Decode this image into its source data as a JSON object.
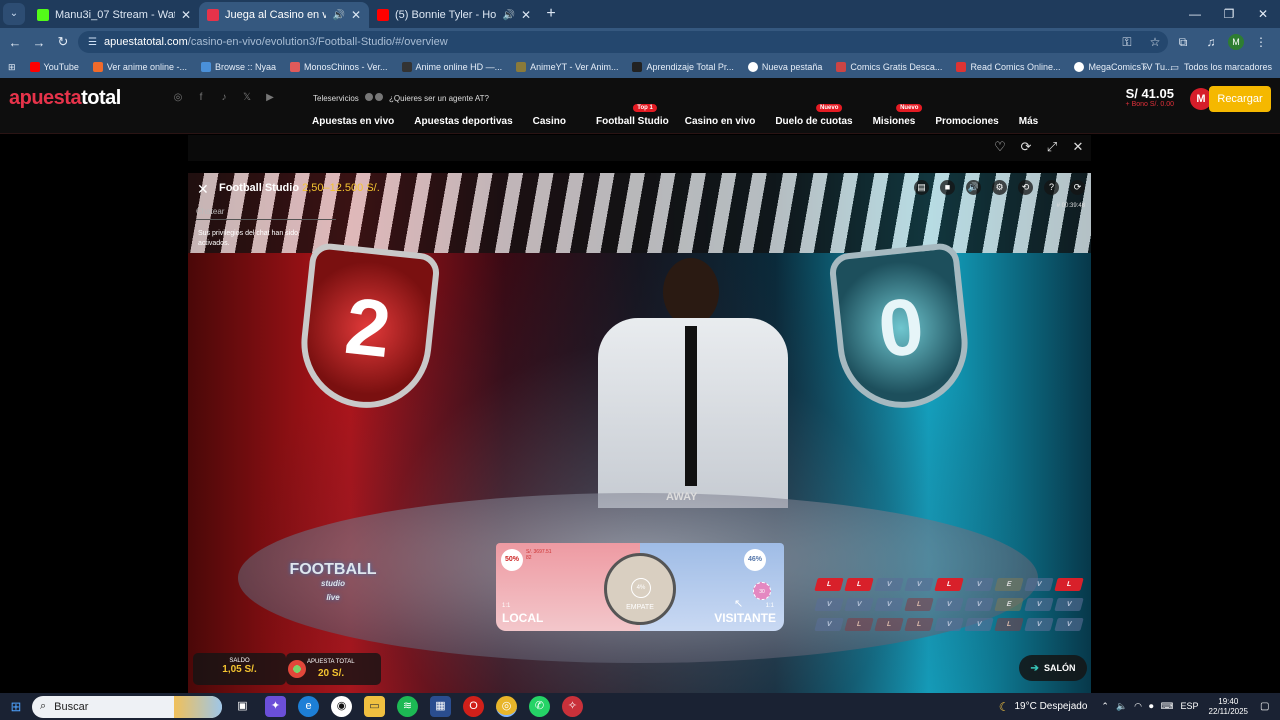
{
  "browser": {
    "tabs": [
      {
        "title": "Manu3i_07 Stream - Watch Live",
        "favicon_color": "#53fc18",
        "active": false
      },
      {
        "title": "Juega al Casino en vivo Onl",
        "favicon_color": "#e6334a",
        "active": true
      },
      {
        "title": "(5) Bonnie Tyler - Holding O",
        "favicon_color": "#ff0000",
        "active": false
      }
    ],
    "url_host": "apuestatotal.com",
    "url_path": "/casino-en-vivo/evolution3/Football-Studio/#/overview",
    "profile_initial": "M",
    "bookmarks": [
      "YouTube",
      "Ver anime online -...",
      "Browse :: Nyaa",
      "MonosChinos - Ver...",
      "Anime online HD —...",
      "AnimeYT - Ver Anim...",
      "Aprendizaje Total Pr...",
      "Nueva pestaña",
      "Comics Gratis Desca...",
      "Read Comics Online...",
      "MegaComicsTV Tu..."
    ],
    "bookmarks_all": "Todos los marcadores"
  },
  "site": {
    "logo_part1": "apuesta",
    "logo_part2": "total",
    "teleservicios": "Teleservicios",
    "agent_text": "¿Quieres ser un agente AT?",
    "nav": [
      {
        "label": "Apuestas en vivo",
        "badge": ""
      },
      {
        "label": "Apuestas deportivas",
        "badge": ""
      },
      {
        "label": "Casino",
        "badge": ""
      },
      {
        "label": "Football Studio",
        "badge": "Top 1"
      },
      {
        "label": "Casino en vivo",
        "badge": ""
      },
      {
        "label": "Duelo de cuotas",
        "badge": "Nuevo"
      },
      {
        "label": "Misiones",
        "badge": "Nuevo"
      },
      {
        "label": "Promociones",
        "badge": ""
      },
      {
        "label": "Más",
        "badge": ""
      }
    ],
    "balance": "S/ 41.05",
    "bono": "+ Bono S/. 0.00",
    "user_initial": "M",
    "recargar": "Recargar"
  },
  "game": {
    "title": "Football Studio",
    "limits": "2,50–12.500 S/.",
    "time": "# 00:39:48",
    "chat_label": "Chatear",
    "chat_message": "Sus privilegios del chat han sido activados.",
    "home_score": "2",
    "away_score": "0",
    "away_table_label": "AWAY",
    "logo_line1": "FOOTBALL",
    "logo_line2": "studio",
    "logo_line3": "live",
    "local": {
      "label": "LOCAL",
      "pct": "50%",
      "odds": "1:1",
      "amount": "S/. 3697.51",
      "players": "82"
    },
    "visitante": {
      "label": "VISITANTE",
      "pct": "46%",
      "odds": "1:1"
    },
    "empate": {
      "label": "EMPATE",
      "pct": "4%"
    },
    "chip_value": "30",
    "history": [
      [
        "L",
        "L",
        "V",
        "V",
        "L",
        "V",
        "E",
        "V",
        "L"
      ],
      [
        "V",
        "V",
        "V",
        "L",
        "V",
        "V",
        "E",
        "V",
        "V"
      ],
      [
        "V",
        "L",
        "L",
        "L",
        "V",
        "V",
        "L",
        "V",
        "V"
      ]
    ],
    "saldo_label": "SALDO",
    "saldo_value": "1,05 S/.",
    "apuesta_label": "APUESTA TOTAL",
    "apuesta_value": "20 S/.",
    "salon": "SALÓN"
  },
  "taskbar": {
    "search": "Buscar",
    "weather": "19°C  Despejado",
    "lang": "ESP",
    "time": "19:40",
    "date": "22/11/2025"
  }
}
